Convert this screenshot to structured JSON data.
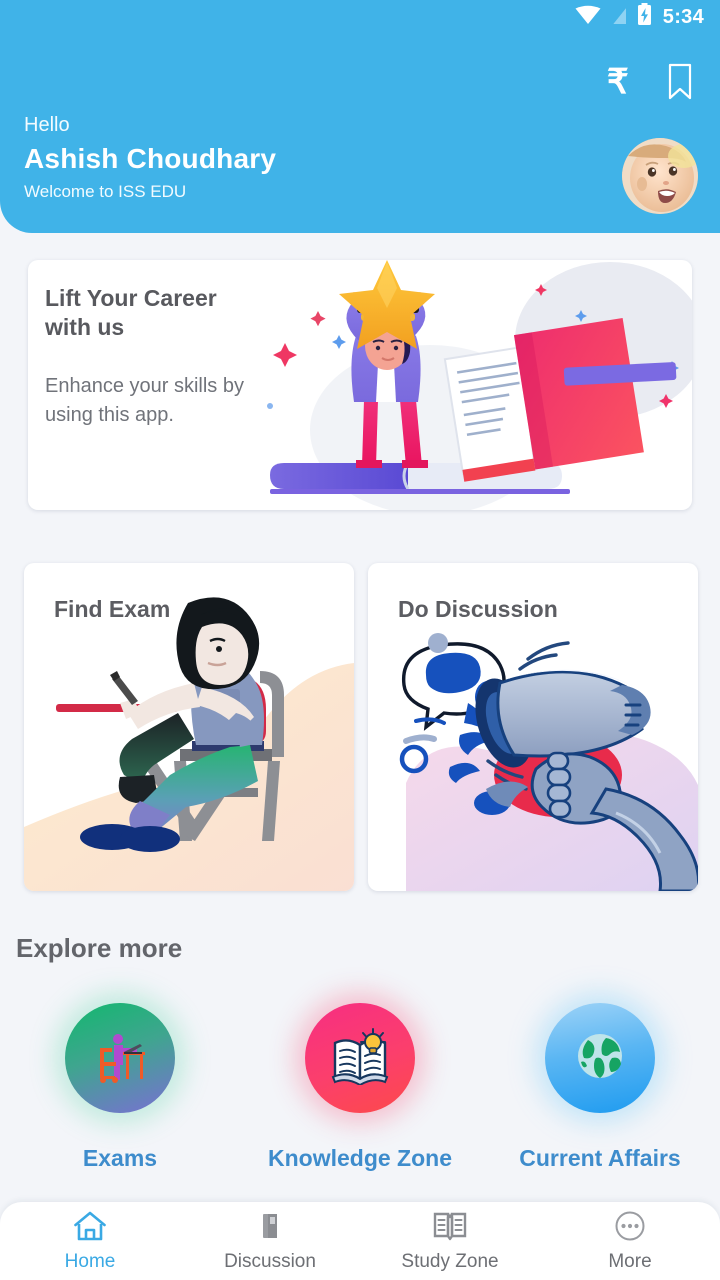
{
  "status_bar": {
    "time": "5:34",
    "icons": [
      "wifi-icon",
      "sim-signal-icon",
      "battery-charging-icon"
    ]
  },
  "header": {
    "background_color": "#40b3e8",
    "greeting": "Hello",
    "user_name": "Ashish Choudhary",
    "welcome": "Welcome to ISS EDU",
    "actions": [
      {
        "name": "rupee-icon",
        "glyph": "₹"
      },
      {
        "name": "bookmark-icon",
        "glyph": "bookmark"
      }
    ],
    "avatar_alt": "avatar"
  },
  "banner": {
    "title": "Lift Your Career with us",
    "subtitle": "Enhance your skills by using this app.",
    "illustration": "student-holding-star-trophy-on-book"
  },
  "feature_cards": [
    {
      "title": "Find Exam",
      "illustration": "student-writing-exam-at-desk"
    },
    {
      "title": "Do Discussion",
      "illustration": "hand-holding-megaphone-with-speech-bubble"
    }
  ],
  "explore": {
    "heading": "Explore more",
    "items": [
      {
        "label": "Exams",
        "icon": "desk-laptop-person-icon",
        "color_from": "#12b86e",
        "color_to": "#7a6fd4"
      },
      {
        "label": "Knowledge Zone",
        "icon": "open-book-lightbulb-icon",
        "color_from": "#f72e82",
        "color_to": "#fd4a4a"
      },
      {
        "label": "Current Affairs",
        "icon": "globe-icon",
        "color_from": "#7dc3f5",
        "color_to": "#1e9bf0"
      }
    ]
  },
  "bottom_nav": {
    "active_color": "#3aa9e4",
    "inactive_color": "#6d6f74",
    "items": [
      {
        "label": "Home",
        "icon": "home-icon",
        "active": true
      },
      {
        "label": "Discussion",
        "icon": "book-stack-icon",
        "active": false
      },
      {
        "label": "Study Zone",
        "icon": "open-book-icon",
        "active": false
      },
      {
        "label": "More",
        "icon": "more-dots-icon",
        "active": false
      }
    ]
  }
}
